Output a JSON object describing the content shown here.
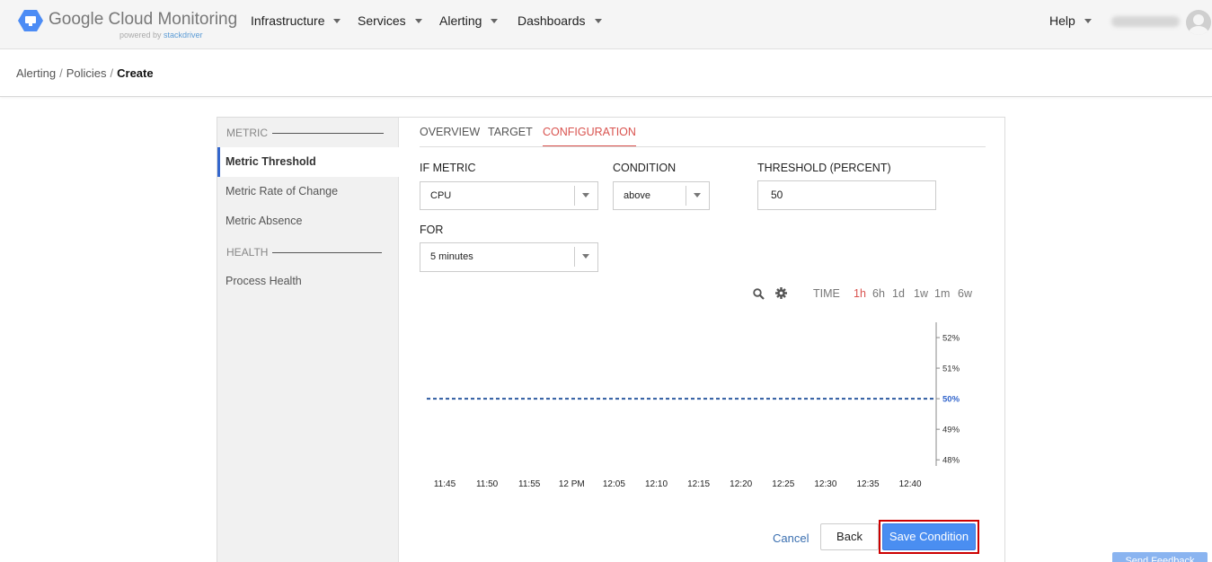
{
  "app": {
    "logo_text": "Google Cloud Monitoring",
    "logo_sub_prefix": "powered by",
    "logo_sub_brand": "stackdriver",
    "logo_icon": "cloud-monitoring-hex-icon"
  },
  "nav": {
    "items": [
      {
        "label": "Infrastructure"
      },
      {
        "label": "Services"
      },
      {
        "label": "Alerting"
      },
      {
        "label": "Dashboards"
      }
    ],
    "help_label": "Help"
  },
  "breadcrumb": {
    "items": [
      "Alerting",
      "Policies"
    ],
    "current": "Create"
  },
  "sidebar": {
    "metric_heading": "METRIC",
    "metric_items": [
      "Metric Threshold",
      "Metric Rate of Change",
      "Metric Absence"
    ],
    "health_heading": "HEALTH",
    "health_items": [
      "Process Health"
    ]
  },
  "tabs": [
    "OVERVIEW",
    "TARGET",
    "CONFIGURATION"
  ],
  "form": {
    "if_metric_label": "IF METRIC",
    "if_metric_value": "CPU",
    "condition_label": "CONDITION",
    "condition_value": "above",
    "threshold_label": "THRESHOLD (PERCENT)",
    "threshold_value": "50",
    "for_label": "FOR",
    "for_value": "5 minutes"
  },
  "chart_controls": {
    "time_label": "TIME",
    "ranges": [
      "1h",
      "6h",
      "1d",
      "1w",
      "1m",
      "6w"
    ],
    "selected_range": "1h"
  },
  "chart_data": {
    "type": "line",
    "x": [
      "11:45",
      "11:50",
      "11:55",
      "12 PM",
      "12:05",
      "12:10",
      "12:15",
      "12:20",
      "12:25",
      "12:30",
      "12:35",
      "12:40"
    ],
    "y_ticks": [
      "52%",
      "51%",
      "50%",
      "49%",
      "48%"
    ],
    "highlighted_tick": "50%",
    "threshold": 50,
    "ylim": [
      47.8,
      52.5
    ],
    "threshold_color": "#2c5aa0"
  },
  "actions": {
    "cancel": "Cancel",
    "back": "Back",
    "save": "Save Condition"
  },
  "footer": {
    "feedback": "Send Feedback"
  },
  "colors": {
    "accent_red": "#d9534f",
    "primary_blue": "#4a8ef1",
    "active_border": "#3366cc"
  }
}
